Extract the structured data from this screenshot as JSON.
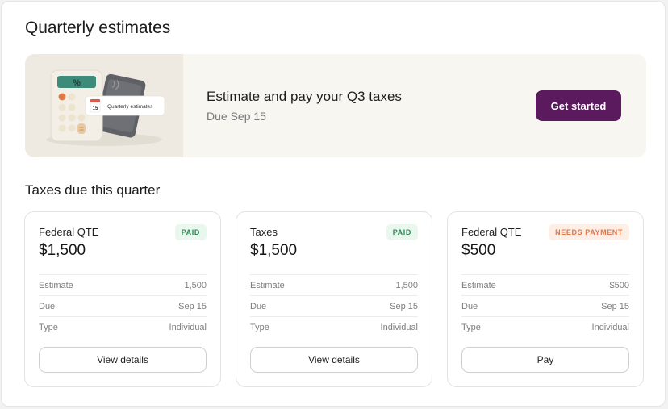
{
  "page": {
    "title": "Quarterly estimates"
  },
  "banner": {
    "heading": "Estimate and pay your Q3 taxes",
    "subtext": "Due Sep 15",
    "cta_label": "Get started",
    "illustration": {
      "tag_label": "Quarterly estimates",
      "calendar_day": "15",
      "calculator_symbol": "%"
    }
  },
  "section": {
    "title": "Taxes due this quarter"
  },
  "cards": [
    {
      "name": "Federal QTE",
      "amount": "$1,500",
      "status": "PAID",
      "rows": [
        {
          "label": "Estimate",
          "value": "1,500"
        },
        {
          "label": "Due",
          "value": "Sep 15"
        },
        {
          "label": "Type",
          "value": "Individual"
        }
      ],
      "button_label": "View details"
    },
    {
      "name": "Taxes",
      "amount": "$1,500",
      "status": "PAID",
      "rows": [
        {
          "label": "Estimate",
          "value": "1,500"
        },
        {
          "label": "Due",
          "value": "Sep 15"
        },
        {
          "label": "Type",
          "value": "Individual"
        }
      ],
      "button_label": "View details"
    },
    {
      "name": "Federal QTE",
      "amount": "$500",
      "status": "NEEDS PAYMENT",
      "rows": [
        {
          "label": "Estimate",
          "value": "$500"
        },
        {
          "label": "Due",
          "value": "Sep 15"
        },
        {
          "label": "Type",
          "value": "Individual"
        }
      ],
      "button_label": "Pay"
    }
  ],
  "colors": {
    "brand": "#5b1a5d",
    "paid_badge_bg": "#eaf7ee",
    "paid_badge_text": "#2d8a55",
    "due_badge_bg": "#fdeee6",
    "due_badge_text": "#e0774a",
    "banner_bg": "#f8f6f1"
  }
}
